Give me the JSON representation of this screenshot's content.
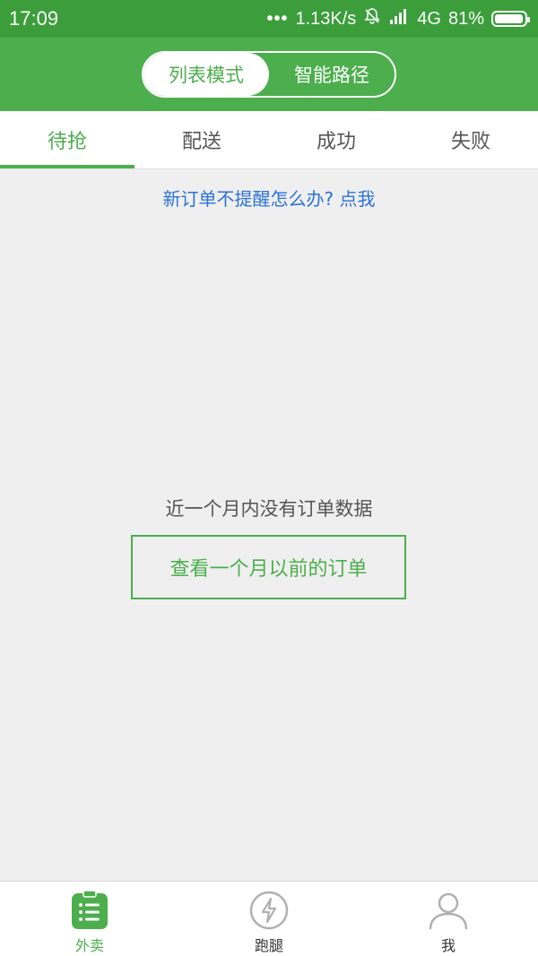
{
  "status_bar": {
    "time": "17:09",
    "dots": "•••",
    "network_speed": "1.13K/s",
    "network_type": "4G",
    "battery": "81%"
  },
  "header": {
    "mode_list": "列表模式",
    "mode_route": "智能路径"
  },
  "tabs": [
    "待抢",
    "配送",
    "成功",
    "失败"
  ],
  "reminder_link": "新订单不提醒怎么办? 点我",
  "empty": {
    "message": "近一个月内没有订单数据",
    "button": "查看一个月以前的订单"
  },
  "bottom_nav": {
    "items": [
      {
        "label": "外卖",
        "icon": "list-icon"
      },
      {
        "label": "跑腿",
        "icon": "lightning-icon"
      },
      {
        "label": "我",
        "icon": "person-icon"
      }
    ]
  },
  "colors": {
    "status_bar": "#3b9e3b",
    "primary": "#4cae4c",
    "link": "#2b72d6",
    "background": "#efefef"
  }
}
